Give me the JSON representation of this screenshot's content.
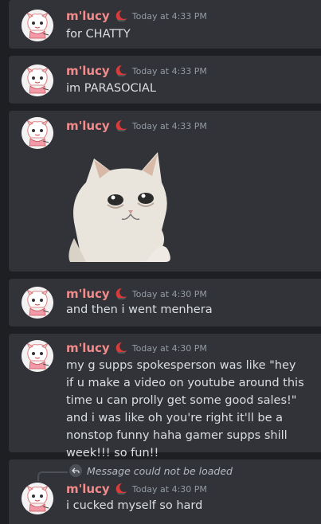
{
  "messages": [
    {
      "username": "m'lucy",
      "timestamp": "Today at 4:33 PM",
      "text": "for CHATTY"
    },
    {
      "username": "m'lucy",
      "timestamp": "Today at 4:33 PM",
      "text": "im PARASOCIAL"
    },
    {
      "username": "m'lucy",
      "timestamp": "Today at 4:33 PM",
      "text": "",
      "attachment": "crying-cat-gif"
    },
    {
      "username": "m'lucy",
      "timestamp": "Today at 4:30 PM",
      "text": "and then i went menhera"
    },
    {
      "username": "m'lucy",
      "timestamp": "Today at 4:30 PM",
      "text": "my g supps spokesperson was like \"hey if u make a video on youtube around this time u can prolly get some good sales!\" and i was like oh you're right it'll be a nonstop funny haha gamer supps shill week!!! so fun!!"
    },
    {
      "username": "m'lucy",
      "timestamp": "Today at 4:30 PM",
      "text": "i cucked myself so hard",
      "reply_text": "Message could not be loaded"
    }
  ],
  "colors": {
    "background": "#1e1f22",
    "message_bg": "#313338",
    "username": "#f28b8b",
    "text": "#dbdee1",
    "timestamp": "#949ba4"
  },
  "icons": {
    "decoration": "red-crescent-decoration-icon",
    "reply": "reply-arrow-icon"
  }
}
